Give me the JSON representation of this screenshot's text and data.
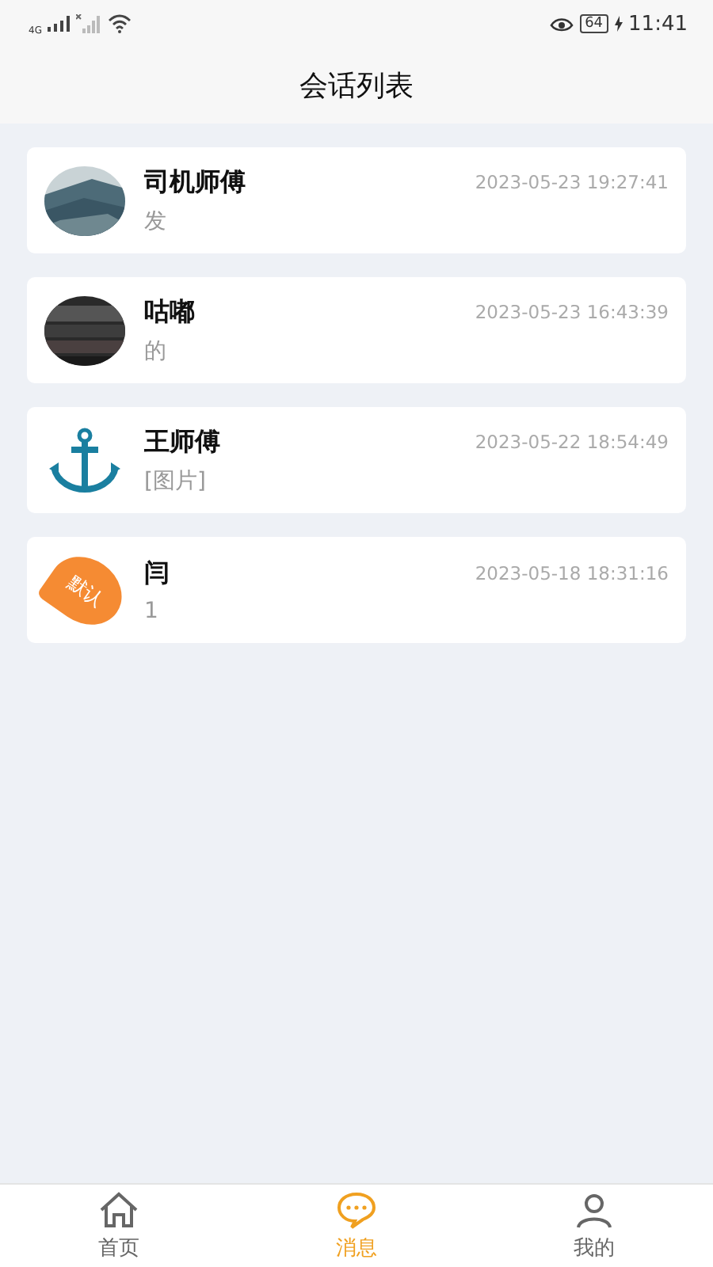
{
  "status_bar": {
    "network": "4G",
    "battery": "64",
    "time": "11:41"
  },
  "header": {
    "title": "会话列表"
  },
  "conversations": [
    {
      "name": "司机师傅",
      "time": "2023-05-23 19:27:41",
      "preview": "发"
    },
    {
      "name": "咕嘟",
      "time": "2023-05-23 16:43:39",
      "preview": "的"
    },
    {
      "name": "王师傅",
      "time": "2023-05-22 18:54:49",
      "preview": "[图片]",
      "avatar": {
        "kind": "anchor"
      }
    },
    {
      "name": "闫",
      "time": "2023-05-18 18:31:16",
      "preview": "1",
      "avatar": {
        "kind": "badge",
        "label": "默认"
      }
    }
  ],
  "tab_bar": [
    {
      "label": "首页",
      "kind": "home",
      "selected": false
    },
    {
      "label": "消息",
      "kind": "chat",
      "selected": true
    },
    {
      "label": "我的",
      "kind": "person",
      "selected": false
    }
  ]
}
